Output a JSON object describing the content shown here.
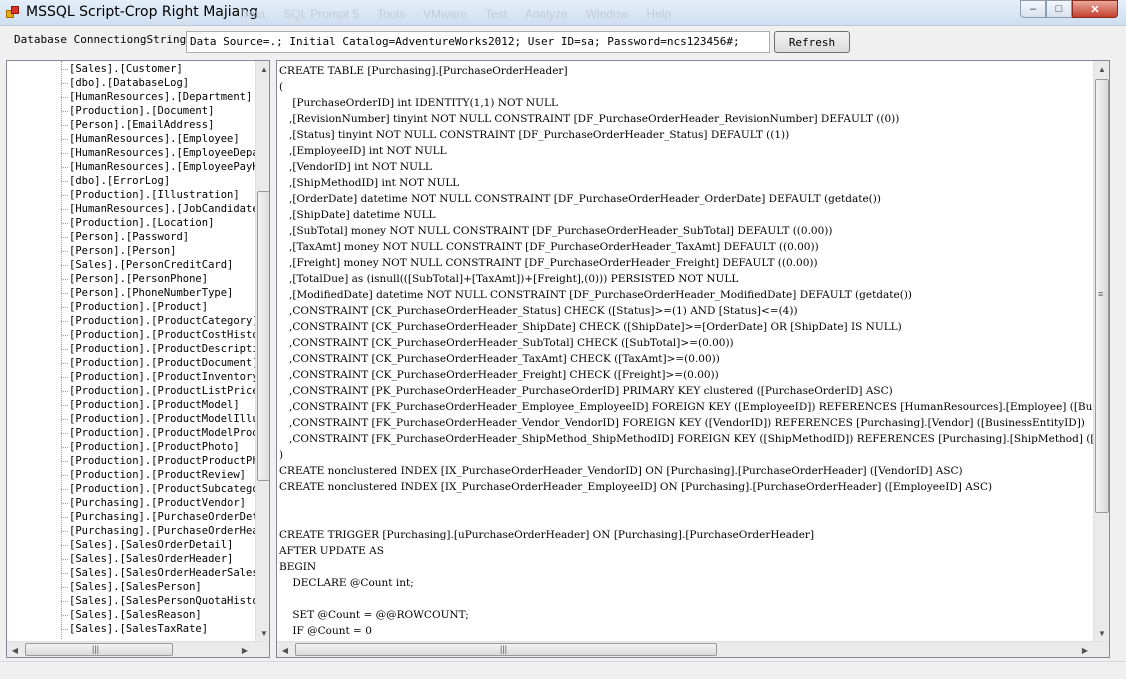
{
  "window": {
    "title": "MSSQL Script-Crop Right Majiang",
    "ghost_menu": [
      "Data",
      "SQL Prompt 5",
      "Tools",
      "VMware",
      "Test",
      "Analyze",
      "Window",
      "Help"
    ],
    "min_label": "–",
    "max_label": "□",
    "close_label": "✕"
  },
  "connection": {
    "label": "Database ConnectiongString:",
    "value": "Data Source=.; Initial Catalog=AdventureWorks2012; User ID=sa; Password=ncs123456#;",
    "refresh_label": "Refresh"
  },
  "tree": {
    "items": [
      "[Sales].[Customer]",
      "[dbo].[DatabaseLog]",
      "[HumanResources].[Department]",
      "[Production].[Document]",
      "[Person].[EmailAddress]",
      "[HumanResources].[Employee]",
      "[HumanResources].[EmployeeDepar",
      "[HumanResources].[EmployeePayHi",
      "[dbo].[ErrorLog]",
      "[Production].[Illustration]",
      "[HumanResources].[JobCandidate]",
      "[Production].[Location]",
      "[Person].[Password]",
      "[Person].[Person]",
      "[Sales].[PersonCreditCard]",
      "[Person].[PersonPhone]",
      "[Person].[PhoneNumberType]",
      "[Production].[Product]",
      "[Production].[ProductCategory]",
      "[Production].[ProductCostHistor",
      "[Production].[ProductDescripti",
      "[Production].[ProductDocument]",
      "[Production].[ProductInventory]",
      "[Production].[ProductListPriceH",
      "[Production].[ProductModel]",
      "[Production].[ProductModelIllus",
      "[Production].[ProductModelProdu",
      "[Production].[ProductPhoto]",
      "[Production].[ProductProductPho",
      "[Production].[ProductReview]",
      "[Production].[ProductSubcategor",
      "[Purchasing].[ProductVendor]",
      "[Purchasing].[PurchaseOrderDeta",
      "[Purchasing].[PurchaseOrderHead",
      "[Sales].[SalesOrderDetail]",
      "[Sales].[SalesOrderHeader]",
      "[Sales].[SalesOrderHeaderSalesR",
      "[Sales].[SalesPerson]",
      "[Sales].[SalesPersonQuotaHistor",
      "[Sales].[SalesReason]",
      "[Sales].[SalesTaxRate]"
    ]
  },
  "editor": {
    "lines": [
      "CREATE TABLE [Purchasing].[PurchaseOrderHeader]",
      "(",
      "    [PurchaseOrderID] int IDENTITY(1,1) NOT NULL",
      "   ,[RevisionNumber] tinyint NOT NULL CONSTRAINT [DF_PurchaseOrderHeader_RevisionNumber] DEFAULT ((0))",
      "   ,[Status] tinyint NOT NULL CONSTRAINT [DF_PurchaseOrderHeader_Status] DEFAULT ((1))",
      "   ,[EmployeeID] int NOT NULL",
      "   ,[VendorID] int NOT NULL",
      "   ,[ShipMethodID] int NOT NULL",
      "   ,[OrderDate] datetime NOT NULL CONSTRAINT [DF_PurchaseOrderHeader_OrderDate] DEFAULT (getdate())",
      "   ,[ShipDate] datetime NULL",
      "   ,[SubTotal] money NOT NULL CONSTRAINT [DF_PurchaseOrderHeader_SubTotal] DEFAULT ((0.00))",
      "   ,[TaxAmt] money NOT NULL CONSTRAINT [DF_PurchaseOrderHeader_TaxAmt] DEFAULT ((0.00))",
      "   ,[Freight] money NOT NULL CONSTRAINT [DF_PurchaseOrderHeader_Freight] DEFAULT ((0.00))",
      "   ,[TotalDue] as (isnull(([SubTotal]+[TaxAmt])+[Freight],(0))) PERSISTED NOT NULL",
      "   ,[ModifiedDate] datetime NOT NULL CONSTRAINT [DF_PurchaseOrderHeader_ModifiedDate] DEFAULT (getdate())",
      "   ,CONSTRAINT [CK_PurchaseOrderHeader_Status] CHECK ([Status]>=(1) AND [Status]<=(4))",
      "   ,CONSTRAINT [CK_PurchaseOrderHeader_ShipDate] CHECK ([ShipDate]>=[OrderDate] OR [ShipDate] IS NULL)",
      "   ,CONSTRAINT [CK_PurchaseOrderHeader_SubTotal] CHECK ([SubTotal]>=(0.00))",
      "   ,CONSTRAINT [CK_PurchaseOrderHeader_TaxAmt] CHECK ([TaxAmt]>=(0.00))",
      "   ,CONSTRAINT [CK_PurchaseOrderHeader_Freight] CHECK ([Freight]>=(0.00))",
      "   ,CONSTRAINT [PK_PurchaseOrderHeader_PurchaseOrderID] PRIMARY KEY clustered ([PurchaseOrderID] ASC)",
      "   ,CONSTRAINT [FK_PurchaseOrderHeader_Employee_EmployeeID] FOREIGN KEY ([EmployeeID]) REFERENCES [HumanResources].[Employee] ([BusinessEntityID])",
      "   ,CONSTRAINT [FK_PurchaseOrderHeader_Vendor_VendorID] FOREIGN KEY ([VendorID]) REFERENCES [Purchasing].[Vendor] ([BusinessEntityID])",
      "   ,CONSTRAINT [FK_PurchaseOrderHeader_ShipMethod_ShipMethodID] FOREIGN KEY ([ShipMethodID]) REFERENCES [Purchasing].[ShipMethod] ([ShipMethodID])",
      ")",
      "CREATE nonclustered INDEX [IX_PurchaseOrderHeader_VendorID] ON [Purchasing].[PurchaseOrderHeader] ([VendorID] ASC)",
      "CREATE nonclustered INDEX [IX_PurchaseOrderHeader_EmployeeID] ON [Purchasing].[PurchaseOrderHeader] ([EmployeeID] ASC)",
      "",
      "",
      "CREATE TRIGGER [Purchasing].[uPurchaseOrderHeader] ON [Purchasing].[PurchaseOrderHeader]",
      "AFTER UPDATE AS",
      "BEGIN",
      "    DECLARE @Count int;",
      "",
      "    SET @Count = @@ROWCOUNT;",
      "    IF @Count = 0"
    ]
  },
  "scroll": {
    "tree_v_position": 0.42,
    "tree_h_position": 0.0,
    "editor_v_position": 0.0,
    "editor_h_position": 0.0
  },
  "icons": {
    "scroll_up": "scroll-up-arrow-icon",
    "scroll_down": "scroll-down-arrow-icon",
    "scroll_left": "scroll-left-arrow-icon",
    "scroll_right": "scroll-right-arrow-icon"
  }
}
